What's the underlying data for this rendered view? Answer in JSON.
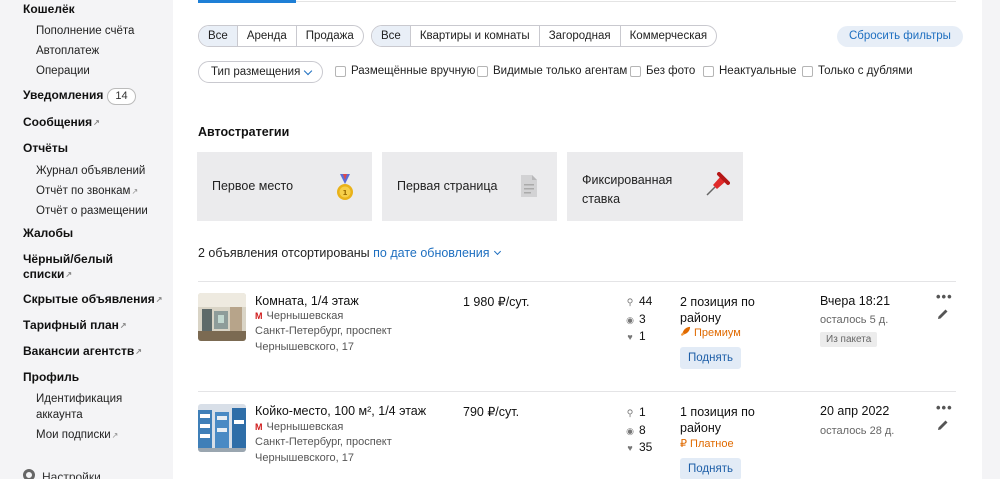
{
  "sidebar": {
    "wallet": "Кошелёк",
    "wallet_items": [
      "Пополнение счёта",
      "Автоплатеж",
      "Операции"
    ],
    "notifications": "Уведомления",
    "notifications_count": "14",
    "messages": "Сообщения",
    "reports": "Отчёты",
    "reports_items": [
      "Журнал объявлений",
      "Отчёт по звонкам",
      "Отчёт о размещении"
    ],
    "complaints": "Жалобы",
    "blacklist_line1": "Чёрный/белый",
    "blacklist_line2": "списки",
    "hidden": "Скрытые объявления",
    "tariff": "Тарифный план",
    "vacancies": "Вакансии агентств",
    "profile": "Профиль",
    "profile_items": [
      "Идентификация",
      "аккаунта",
      "Мои подписки"
    ],
    "settings": "Настройки"
  },
  "filters": {
    "deal_tabs": [
      "Все",
      "Аренда",
      "Продажа"
    ],
    "type_tabs": [
      "Все",
      "Квартиры и комнаты",
      "Загородная",
      "Коммерческая"
    ],
    "reset": "Сбросить фильтры",
    "placement_type": "Тип размещения",
    "checkboxes": [
      "Размещённые вручную",
      "Видимые только агентам",
      "Без фото",
      "Неактуальные",
      "Только с дублями"
    ]
  },
  "autostrategies": {
    "title": "Автостратегии",
    "cards": [
      "Первое место",
      "Первая страница",
      "Фиксированная",
      "ставка"
    ]
  },
  "sort": {
    "text": "2 объявления отсортированы",
    "link": "по дате обновления"
  },
  "listings": [
    {
      "title": "Комната, 1/4 этаж",
      "metro_icon": "М",
      "metro": "Чернышевская",
      "addr1": "Санкт-Петербург, проспект",
      "addr2": "Чернышевского, 17",
      "price": "1 980 ₽/сут.",
      "searches": "44",
      "views": "3",
      "likes": "1",
      "pos1": "2 позиция по",
      "pos2": "району",
      "tier": "Премиум",
      "tier_icon": "rocket-icon",
      "raise": "Поднять",
      "date": "Вчера 18:21",
      "left": "осталось 5 д.",
      "pkg": "Из пакета"
    },
    {
      "title": "Койко-место, 100 м², 1/4 этаж",
      "metro_icon": "М",
      "metro": "Чернышевская",
      "addr1": "Санкт-Петербург, проспект",
      "addr2": "Чернышевского, 17",
      "price": "790 ₽/сут.",
      "searches": "1",
      "views": "8",
      "likes": "35",
      "pos1": "1 позиция по",
      "pos2": "району",
      "tier": "₽ Платное",
      "raise": "Поднять",
      "date": "20 апр 2022",
      "left": "осталось 28 д."
    }
  ],
  "colors": {
    "accent": "#1e6fc0",
    "premium": "#e06a00",
    "metro": "#d01c1c"
  }
}
